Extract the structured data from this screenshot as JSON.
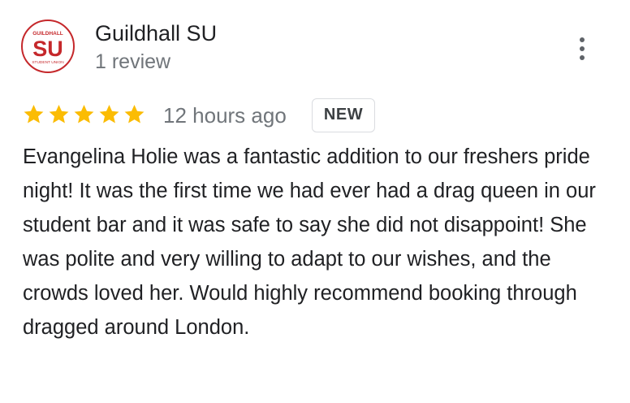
{
  "reviewer": {
    "avatar_logo": {
      "top_text": "GUILDHALL",
      "main_text": "SU",
      "bottom_text": "STUDENT UNION",
      "color": "#c5282b"
    },
    "name": "Guildhall SU",
    "review_count": "1 review"
  },
  "review": {
    "rating": 5,
    "max_rating": 5,
    "star_color": "#fbbc04",
    "time": "12 hours ago",
    "badge": "NEW",
    "text": "Evangelina Holie was a fantastic addition to our freshers pride night! It was the first time we had ever had a drag queen in our student bar and it was safe to say she did not disappoint! She was polite and very willing to adapt to our wishes, and the crowds loved her. Would highly recommend booking through dragged around London."
  },
  "icons": {
    "menu": "more-vert-icon",
    "star": "star-icon"
  }
}
